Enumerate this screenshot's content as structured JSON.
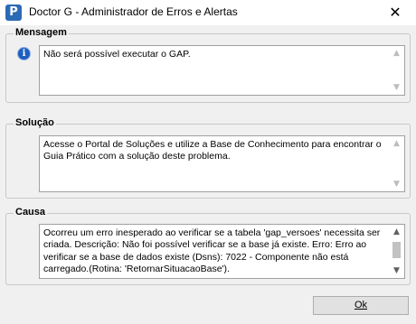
{
  "window": {
    "title": "Doctor G - Administrador de Erros e Alertas",
    "icon_letter": "P",
    "close_glyph": "✕"
  },
  "mensagem": {
    "label": "Mensagem",
    "icon": "info-icon",
    "icon_glyph": "i",
    "text": "Não será possível executar o GAP."
  },
  "solucao": {
    "label": "Solução",
    "text": "Acesse o Portal de Soluções e utilize a Base de Conhecimento para encontrar o Guia Prático com a solução deste problema."
  },
  "causa": {
    "label": "Causa",
    "text": "Ocorreu um erro inesperado ao verificar se a tabela 'gap_versoes' necessita ser criada. Descrição: Não foi possível verificar se a base já existe. Erro: Erro ao verificar se a base de dados existe (Dsns):  7022 - Componente não está carregado.(Rotina: 'RetornarSituacaoBase')."
  },
  "buttons": {
    "ok_label": "Ok"
  },
  "colors": {
    "accent": "#2b6bb5",
    "info": "#1f5fbf",
    "background": "#f0f0f0"
  }
}
